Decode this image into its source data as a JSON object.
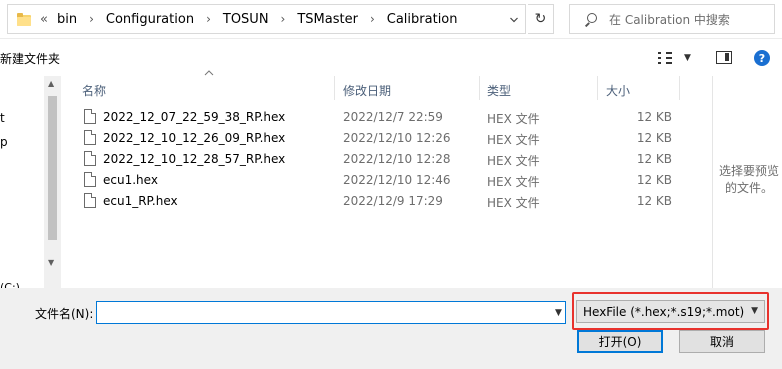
{
  "address_bar": {
    "overflow_symbol": "«",
    "breadcrumbs": [
      "bin",
      "Configuration",
      "TOSUN",
      "TSMaster",
      "Calibration"
    ],
    "separator": "›",
    "refresh_symbol": "↻"
  },
  "search": {
    "placeholder": "在 Calibration 中搜索"
  },
  "toolbar": {
    "new_folder_label": "新建文件夹",
    "help_symbol": "?"
  },
  "nav_pane": {
    "items": [
      "t",
      "p"
    ],
    "drive_label": "(C:)"
  },
  "columns": {
    "name": "名称",
    "modified": "修改日期",
    "type": "类型",
    "size": "大小"
  },
  "files": [
    {
      "name": "2022_12_07_22_59_38_RP.hex",
      "modified": "2022/12/7 22:59",
      "type": "HEX 文件",
      "size": "12 KB"
    },
    {
      "name": "2022_12_10_12_26_09_RP.hex",
      "modified": "2022/12/10 12:26",
      "type": "HEX 文件",
      "size": "12 KB"
    },
    {
      "name": "2022_12_10_12_28_57_RP.hex",
      "modified": "2022/12/10 12:28",
      "type": "HEX 文件",
      "size": "12 KB"
    },
    {
      "name": "ecu1.hex",
      "modified": "2022/12/10 12:46",
      "type": "HEX 文件",
      "size": "12 KB"
    },
    {
      "name": "ecu1_RP.hex",
      "modified": "2022/12/9 17:29",
      "type": "HEX 文件",
      "size": "12 KB"
    }
  ],
  "preview_pane": {
    "message_line1": "选择要预览",
    "message_line2": "的文件。"
  },
  "file_name": {
    "label": "文件名(N):",
    "value": ""
  },
  "file_type": {
    "selected": "HexFile (*.hex;*.s19;*.mot)",
    "highlight_color": "#e8322d"
  },
  "buttons": {
    "open": "打开(O)",
    "cancel": "取消"
  }
}
